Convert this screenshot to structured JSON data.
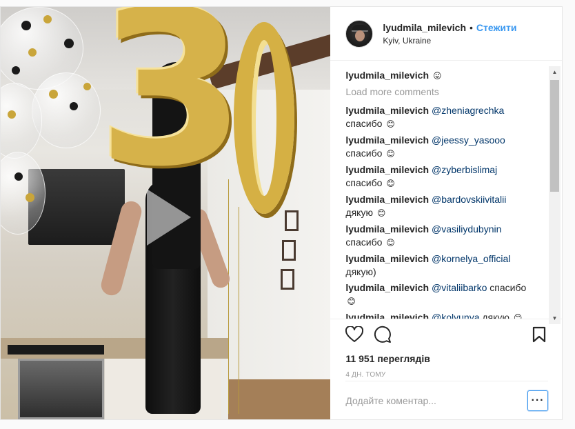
{
  "header": {
    "username": "lyudmila_milevich",
    "separator": "•",
    "follow_label": "Стежити",
    "location": "Kyiv, Ukraine"
  },
  "comments": {
    "caption": {
      "user": "lyudmila_milevich",
      "emoji": "😛"
    },
    "load_more_label": "Load more comments",
    "items": [
      {
        "user": "lyudmila_milevich",
        "mention": "@zheniagrechka",
        "text": "спасибо",
        "emoji": "😊"
      },
      {
        "user": "lyudmila_milevich",
        "mention": "@jeessy_yasooo",
        "text": "спасибо",
        "emoji": "😊"
      },
      {
        "user": "lyudmila_milevich",
        "mention": "@zyberbislimaj",
        "text": "спасибо",
        "emoji": "😊"
      },
      {
        "user": "lyudmila_milevich",
        "mention": "@bardovskiivitalii",
        "text": "дякую",
        "emoji": "😊"
      },
      {
        "user": "lyudmila_milevich",
        "mention": "@vasiliydubynin",
        "text": "спасибо",
        "emoji": "😊"
      },
      {
        "user": "lyudmila_milevich",
        "mention": "@kornelya_official",
        "text": "дякую)",
        "emoji": ""
      },
      {
        "user": "lyudmila_milevich",
        "mention": "@vitaliibarko",
        "text": "спасибо",
        "emoji": "😊"
      },
      {
        "user": "lyudmila_milevich",
        "mention": "@kolyunya",
        "text": "дякую",
        "emoji": "😊"
      }
    ]
  },
  "actions": {
    "like_icon": "heart-outline-icon",
    "comment_icon": "speech-bubble-icon",
    "save_icon": "bookmark-icon"
  },
  "stats": {
    "views": "11 951 переглядів",
    "age": "4 ДН. ТОМУ"
  },
  "composer": {
    "placeholder": "Додайте коментар...",
    "more_label": "···"
  },
  "media": {
    "type": "video",
    "play_icon": "play-triangle-icon"
  },
  "colors": {
    "link_blue": "#3897f0",
    "mention_blue": "#003569",
    "muted": "#999999",
    "balloon_gold": "#d6b24a"
  }
}
